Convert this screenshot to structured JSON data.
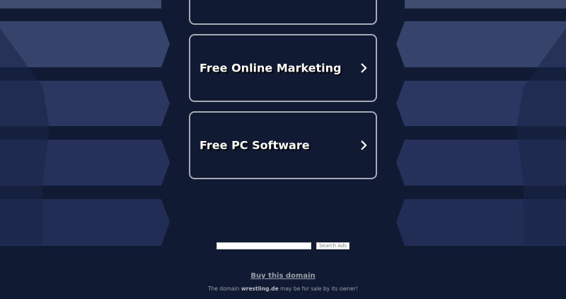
{
  "links": [
    {
      "label": ""
    },
    {
      "label": "Free Online Marketing"
    },
    {
      "label": "Free PC Software"
    }
  ],
  "search": {
    "value": "",
    "button_label": "Search Ads"
  },
  "buy_domain": {
    "label": "Buy this domain"
  },
  "footer": {
    "prefix": "The domain ",
    "domain": "wrestling.de",
    "suffix": " may be for sale by its owner!"
  },
  "colors": {
    "background": "#101a33",
    "box_border": "#a7aab2",
    "text": "#ffffff"
  },
  "icons": {
    "link_arrow": "chevron-right-icon"
  }
}
